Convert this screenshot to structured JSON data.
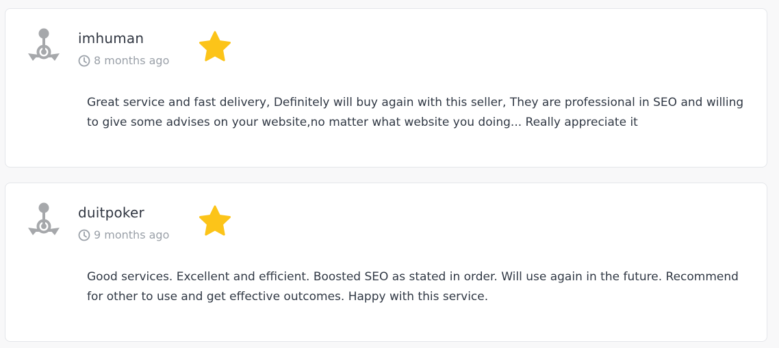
{
  "reviews": [
    {
      "username": "imhuman",
      "time_ago": "8 months ago",
      "rating_stars": 1,
      "text": "Great service and fast delivery, Definitely will buy again with this seller, They are professional in SEO and willing to give some advises on your website,no matter what website you doing... Really appreciate it"
    },
    {
      "username": "duitpoker",
      "time_ago": "9 months ago",
      "rating_stars": 1,
      "text": "Good services. Excellent and efficient. Boosted SEO as stated in order. Will use again in the future. Recommend for other to use and get effective outcomes. Happy with this service."
    }
  ],
  "icons": {
    "avatar": "default-avatar-icon",
    "clock": "clock-icon",
    "star": "star-icon"
  },
  "colors": {
    "star": "#fcc419",
    "avatar": "#a6a8ab",
    "muted_text": "#9aa0a8",
    "body_text": "#303844"
  }
}
